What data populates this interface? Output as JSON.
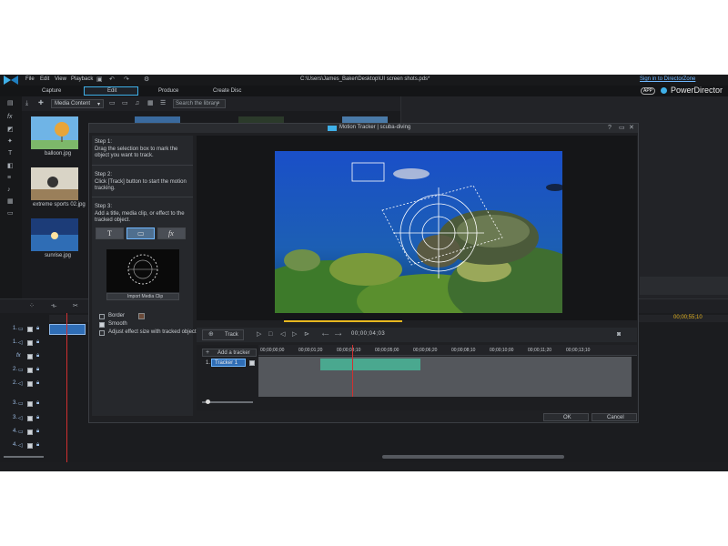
{
  "menu": [
    "File",
    "Edit",
    "View",
    "Playback"
  ],
  "file_path": "C:\\Users\\James_Baker\\Desktop\\UI screen shots.pds*",
  "sign_in_label": "Sign in to DirectorZone",
  "app_badge": "APP",
  "app_name": "PowerDirector",
  "tabs": [
    "Capture",
    "Edit",
    "Produce",
    "Create Disc"
  ],
  "library": {
    "dropdown": "Media Content",
    "search_placeholder": "Search the library",
    "items": [
      {
        "name": "balloon.jpg"
      },
      {
        "name": "extreme sports 02.jpg"
      },
      {
        "name": "sunrise.jpg"
      }
    ]
  },
  "dialog": {
    "title": "Motion Tracker  |  scuba-diving",
    "step1_title": "Step 1:",
    "step1_text": "Drag the selection box to mark the object you want to track.",
    "step2_title": "Step 2:",
    "step2_text": "Click [Track] button to start the motion tracking.",
    "step3_title": "Step 3:",
    "step3_text": "Add a title, media clip, or effect to the tracked object.",
    "step3_tabs": [
      "T",
      "▭",
      "fx"
    ],
    "import_label": "Import Media Clip",
    "options": [
      {
        "label": "Border",
        "checked": false
      },
      {
        "label": "Smooth",
        "checked": true
      },
      {
        "label": "Adjust effect size with tracked object",
        "checked": false
      }
    ],
    "track_button": "Track",
    "timecode": "00;00;04;03",
    "add_tracker": "Add a tracker",
    "ruler_labels": [
      "00;00;00;00",
      "00;00;01;20",
      "00;00;03;10",
      "00;00;05;00",
      "00;00;06;20",
      "00;00;08;10",
      "00;00;10;00",
      "00;00;11;20",
      "00;00;13;10"
    ],
    "tracker_index": "1.",
    "tracker_name": "Tracker 1",
    "ok": "OK",
    "cancel": "Cancel"
  },
  "timeline": {
    "timecode_right": "00;00;55;10",
    "track_labels": [
      "1.",
      "1.",
      "fx",
      "2.",
      "2.",
      "3.",
      "3.",
      "4.",
      "4."
    ]
  },
  "colors": {
    "accent": "#3fb0e8",
    "tracker_clip": "#4aa88f",
    "playhead": "#d03030",
    "range": "#e8b820"
  }
}
